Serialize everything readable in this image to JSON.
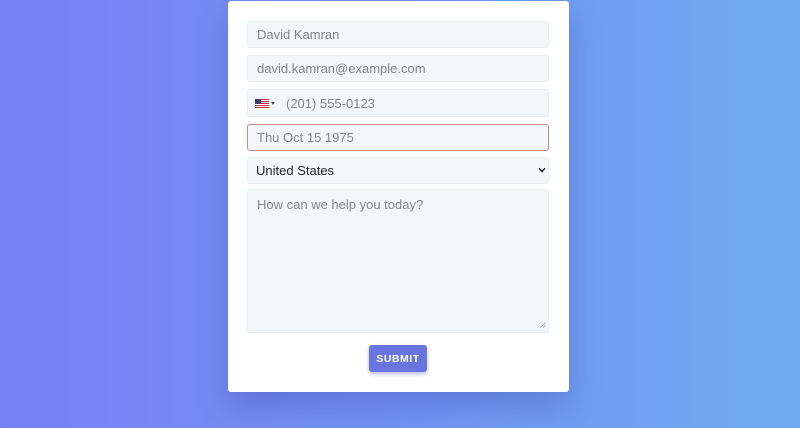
{
  "form": {
    "name_placeholder": "David Kamran",
    "email_placeholder": "david.kamran@example.com",
    "phone": {
      "country_flag": "us-flag-icon",
      "placeholder": "(201) 555-0123"
    },
    "date_placeholder": "Thu Oct 15 1975",
    "country_select": {
      "selected": "United States"
    },
    "message_placeholder": "How can we help you today?",
    "submit_label": "SUBMIT"
  },
  "colors": {
    "background_start": "#7880f5",
    "background_end": "#6fabf0",
    "field_background": "#f3f7fa",
    "invalid_border": "#c98a80",
    "submit_button": "#6874e0"
  }
}
